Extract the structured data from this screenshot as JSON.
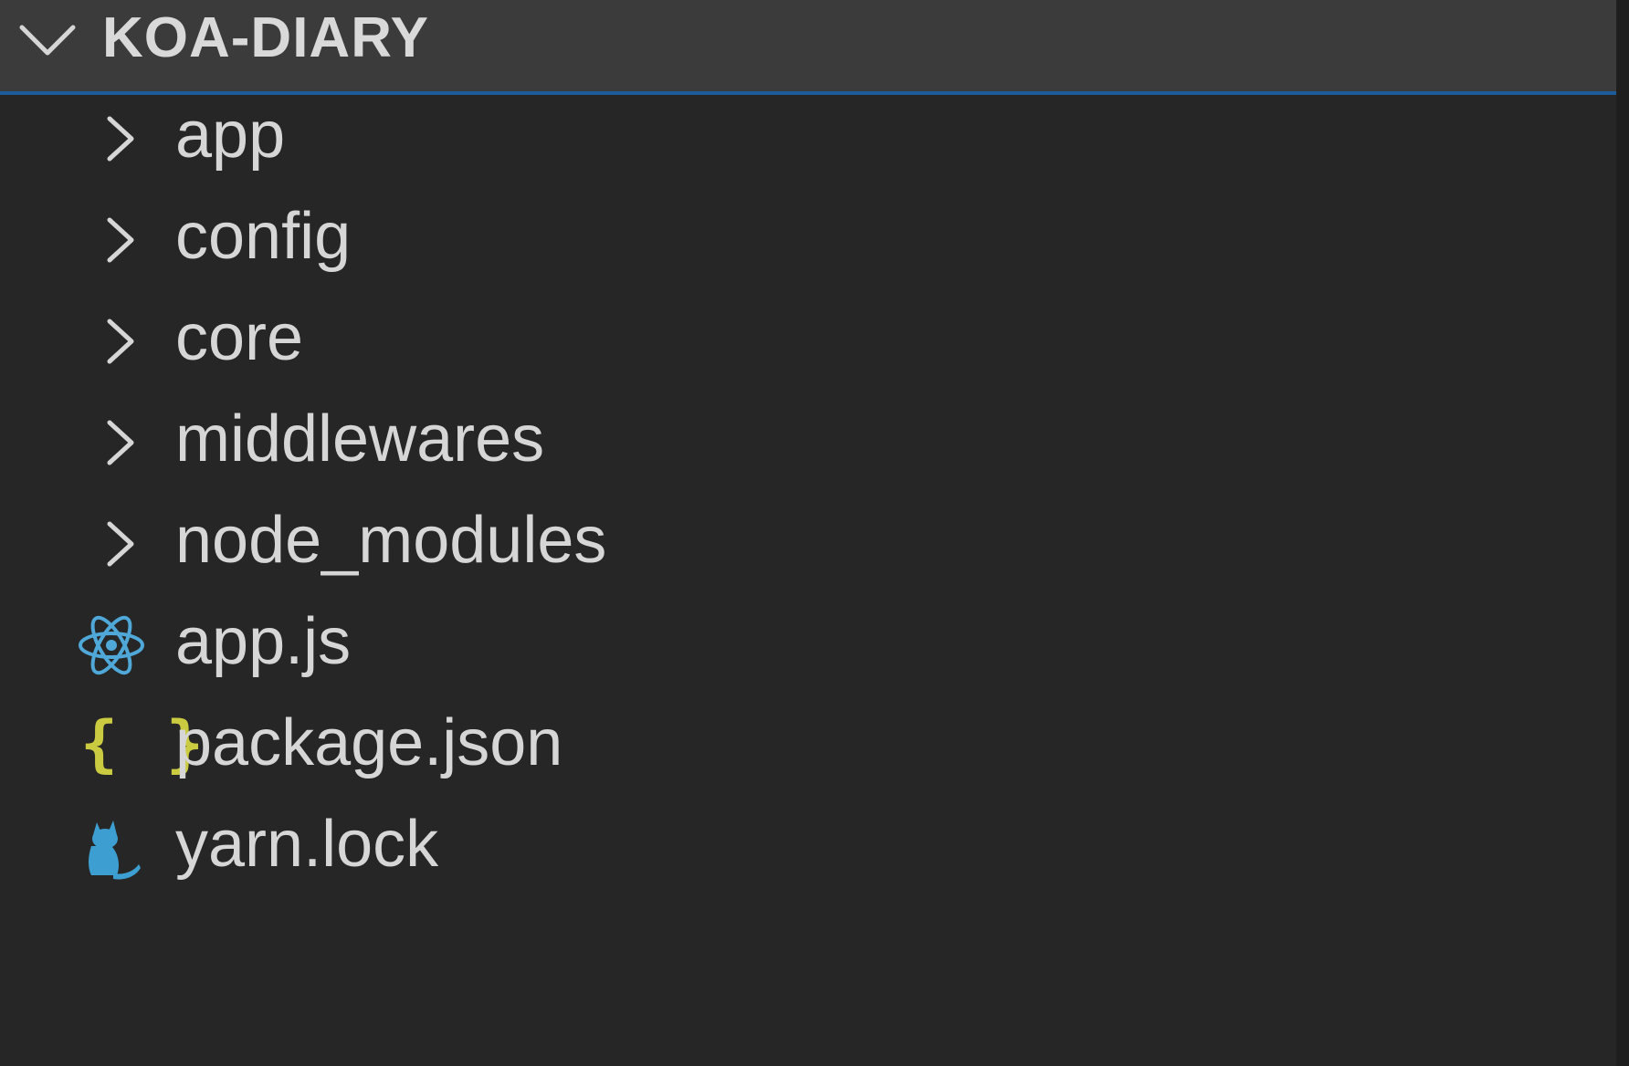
{
  "explorer": {
    "title": "KOA-DIARY",
    "items": [
      {
        "label": "app",
        "kind": "folder",
        "icon": "chevron-right-icon"
      },
      {
        "label": "config",
        "kind": "folder",
        "icon": "chevron-right-icon"
      },
      {
        "label": "core",
        "kind": "folder",
        "icon": "chevron-right-icon"
      },
      {
        "label": "middlewares",
        "kind": "folder",
        "icon": "chevron-right-icon"
      },
      {
        "label": "node_modules",
        "kind": "folder",
        "icon": "chevron-right-icon"
      },
      {
        "label": "app.js",
        "kind": "file",
        "icon": "react-atom-icon"
      },
      {
        "label": "package.json",
        "kind": "file",
        "icon": "json-braces-icon",
        "icon_text": "{ }"
      },
      {
        "label": "yarn.lock",
        "kind": "file",
        "icon": "yarn-cat-icon"
      }
    ]
  },
  "colors": {
    "header_bg": "#3b3b3b",
    "panel_bg": "#262626",
    "focus_border": "#1d5c9a",
    "text": "#d6d6d6",
    "react_icon": "#4fa8d8",
    "json_icon": "#cbcb41",
    "yarn_icon": "#3d9fd1"
  }
}
